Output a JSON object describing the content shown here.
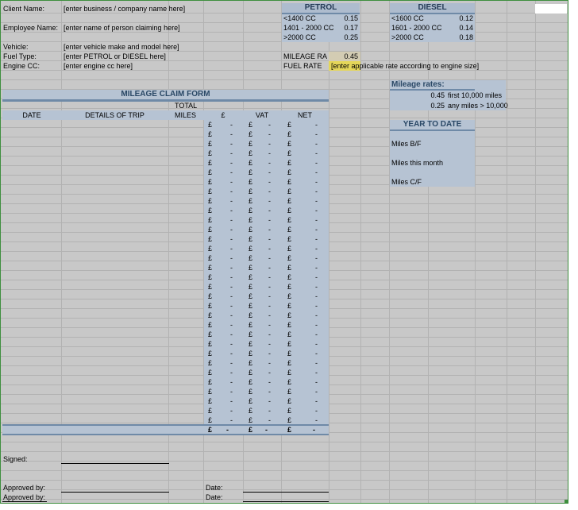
{
  "client": {
    "client_label": "Client Name:",
    "client_value": "[enter business / company name here]",
    "employee_label": "Employee Name:",
    "employee_value": "[enter name of person claiming here]",
    "vehicle_label": "Vehicle:",
    "vehicle_value": "[enter vehicle make and model here]",
    "fuel_label": "Fuel Type:",
    "fuel_value": "[enter PETROL or DIESEL here]",
    "engine_label": "Engine CC:",
    "engine_value": "[enter engine cc here]"
  },
  "petrol": {
    "title": "PETROL",
    "rows": [
      {
        "band": "<1400 CC",
        "rate": "0.15"
      },
      {
        "band": "1401 - 2000 CC",
        "rate": "0.17"
      },
      {
        "band": ">2000 CC",
        "rate": "0.25"
      }
    ]
  },
  "diesel": {
    "title": "DIESEL",
    "rows": [
      {
        "band": "<1600 CC",
        "rate": "0.12"
      },
      {
        "band": "1601 - 2000 CC",
        "rate": "0.14"
      },
      {
        "band": ">2000 CC",
        "rate": "0.18"
      }
    ]
  },
  "mileage_rate": {
    "label": "MILEAGE RA",
    "value": "0.45"
  },
  "fuel_rate": {
    "label": "FUEL RATE",
    "value": "[enter applicable rate according to engine size]"
  },
  "mileage_rates": {
    "title": "Mileage rates:",
    "rows": [
      {
        "rate": "0.45",
        "desc": "first 10,000 miles"
      },
      {
        "rate": "0.25",
        "desc": "any miles > 10,000"
      }
    ]
  },
  "year_to_date": {
    "title": "YEAR TO DATE",
    "miles_bf": "Miles B/F",
    "miles_month": "Miles this month",
    "miles_cf": "Miles C/F"
  },
  "form": {
    "title": "MILEAGE CLAIM FORM",
    "col_total": "TOTAL",
    "col_date": "DATE",
    "col_details": "DETAILS OF TRIP",
    "col_miles": "MILES",
    "col_pound": "£",
    "col_vat": "VAT",
    "col_net": "NET",
    "currency": "£",
    "dash": "-",
    "row_count": 32
  },
  "footer": {
    "signed": "Signed:",
    "approved1": "Approved by:",
    "approved2": "Approved by:",
    "date1": "Date:",
    "date2": "Date:"
  }
}
